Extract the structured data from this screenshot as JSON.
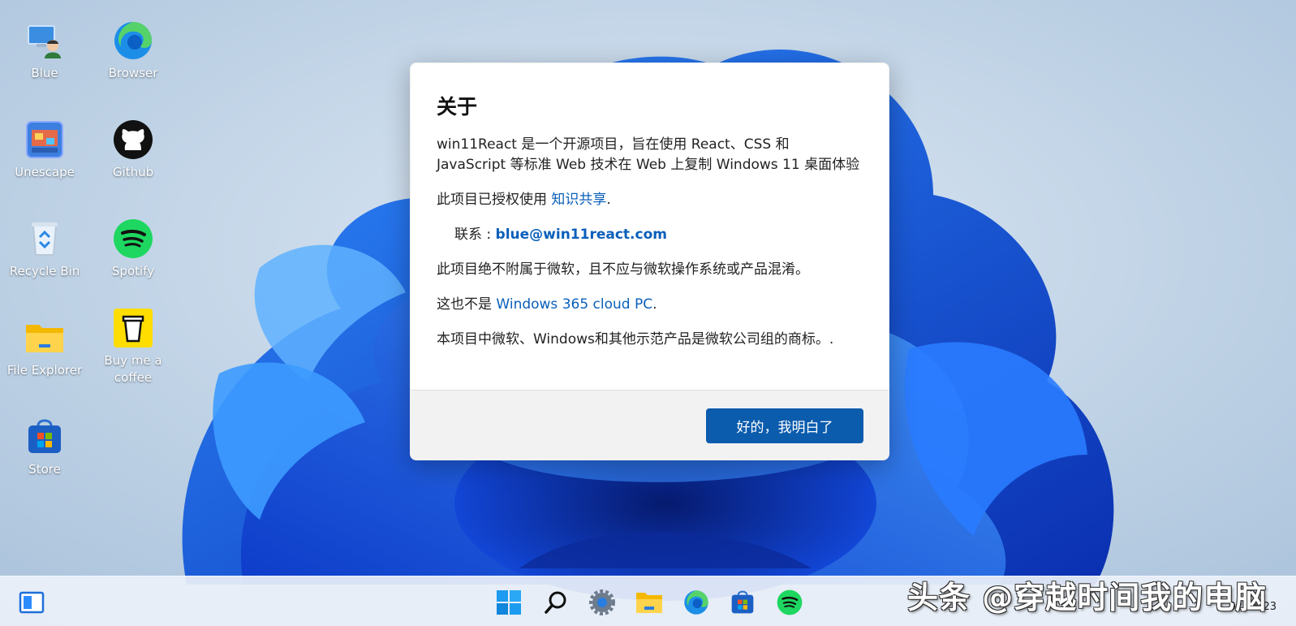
{
  "desktop": {
    "icons": [
      {
        "label": "Blue",
        "icon": "user-computer-icon"
      },
      {
        "label": "Browser",
        "icon": "edge-browser-icon"
      },
      {
        "label": "Unescape",
        "icon": "unescape-game-icon"
      },
      {
        "label": "Github",
        "icon": "github-icon"
      },
      {
        "label": "Recycle Bin",
        "icon": "recycle-bin-icon"
      },
      {
        "label": "Spotify",
        "icon": "spotify-icon"
      },
      {
        "label": "File Explorer",
        "icon": "folder-icon"
      },
      {
        "label": "Buy me a coffee",
        "icon": "coffee-cup-icon"
      },
      {
        "label": "Store",
        "icon": "store-bag-icon"
      }
    ]
  },
  "dialog": {
    "title": "关于",
    "intro": "win11React 是一个开源项目，旨在使用 React、CSS 和 JavaScript 等标准 Web 技术在 Web 上复制 Windows 11 桌面体验",
    "license_prefix": "此项目已授权使用 ",
    "license_link": "知识共享",
    "license_suffix": ".",
    "contact_label": "联系 : ",
    "contact_email": "blue@win11react.com",
    "disclaimer": "此项目绝不附属于微软，且不应与微软操作系统或产品混淆。",
    "cloud_prefix": "这也不是 ",
    "cloud_link": "Windows 365 cloud PC",
    "cloud_suffix": ".",
    "trademark": "本项目中微软、Windows和其他示范产品是微软公司组的商标。.",
    "ok_button": "好的，我明白了"
  },
  "taskbar": {
    "items": [
      "widgets-icon",
      "start-icon",
      "search-icon",
      "settings-gear-icon",
      "file-explorer-icon",
      "edge-browser-icon",
      "store-icon",
      "spotify-icon"
    ],
    "date": "02/25/23"
  },
  "watermark": "头条 @穿越时间我的电脑",
  "colors": {
    "accent": "#0b5cad",
    "link": "#0a5fba",
    "wallpaper_bg": "#b9cde0",
    "bloom": "#1a5be8"
  }
}
